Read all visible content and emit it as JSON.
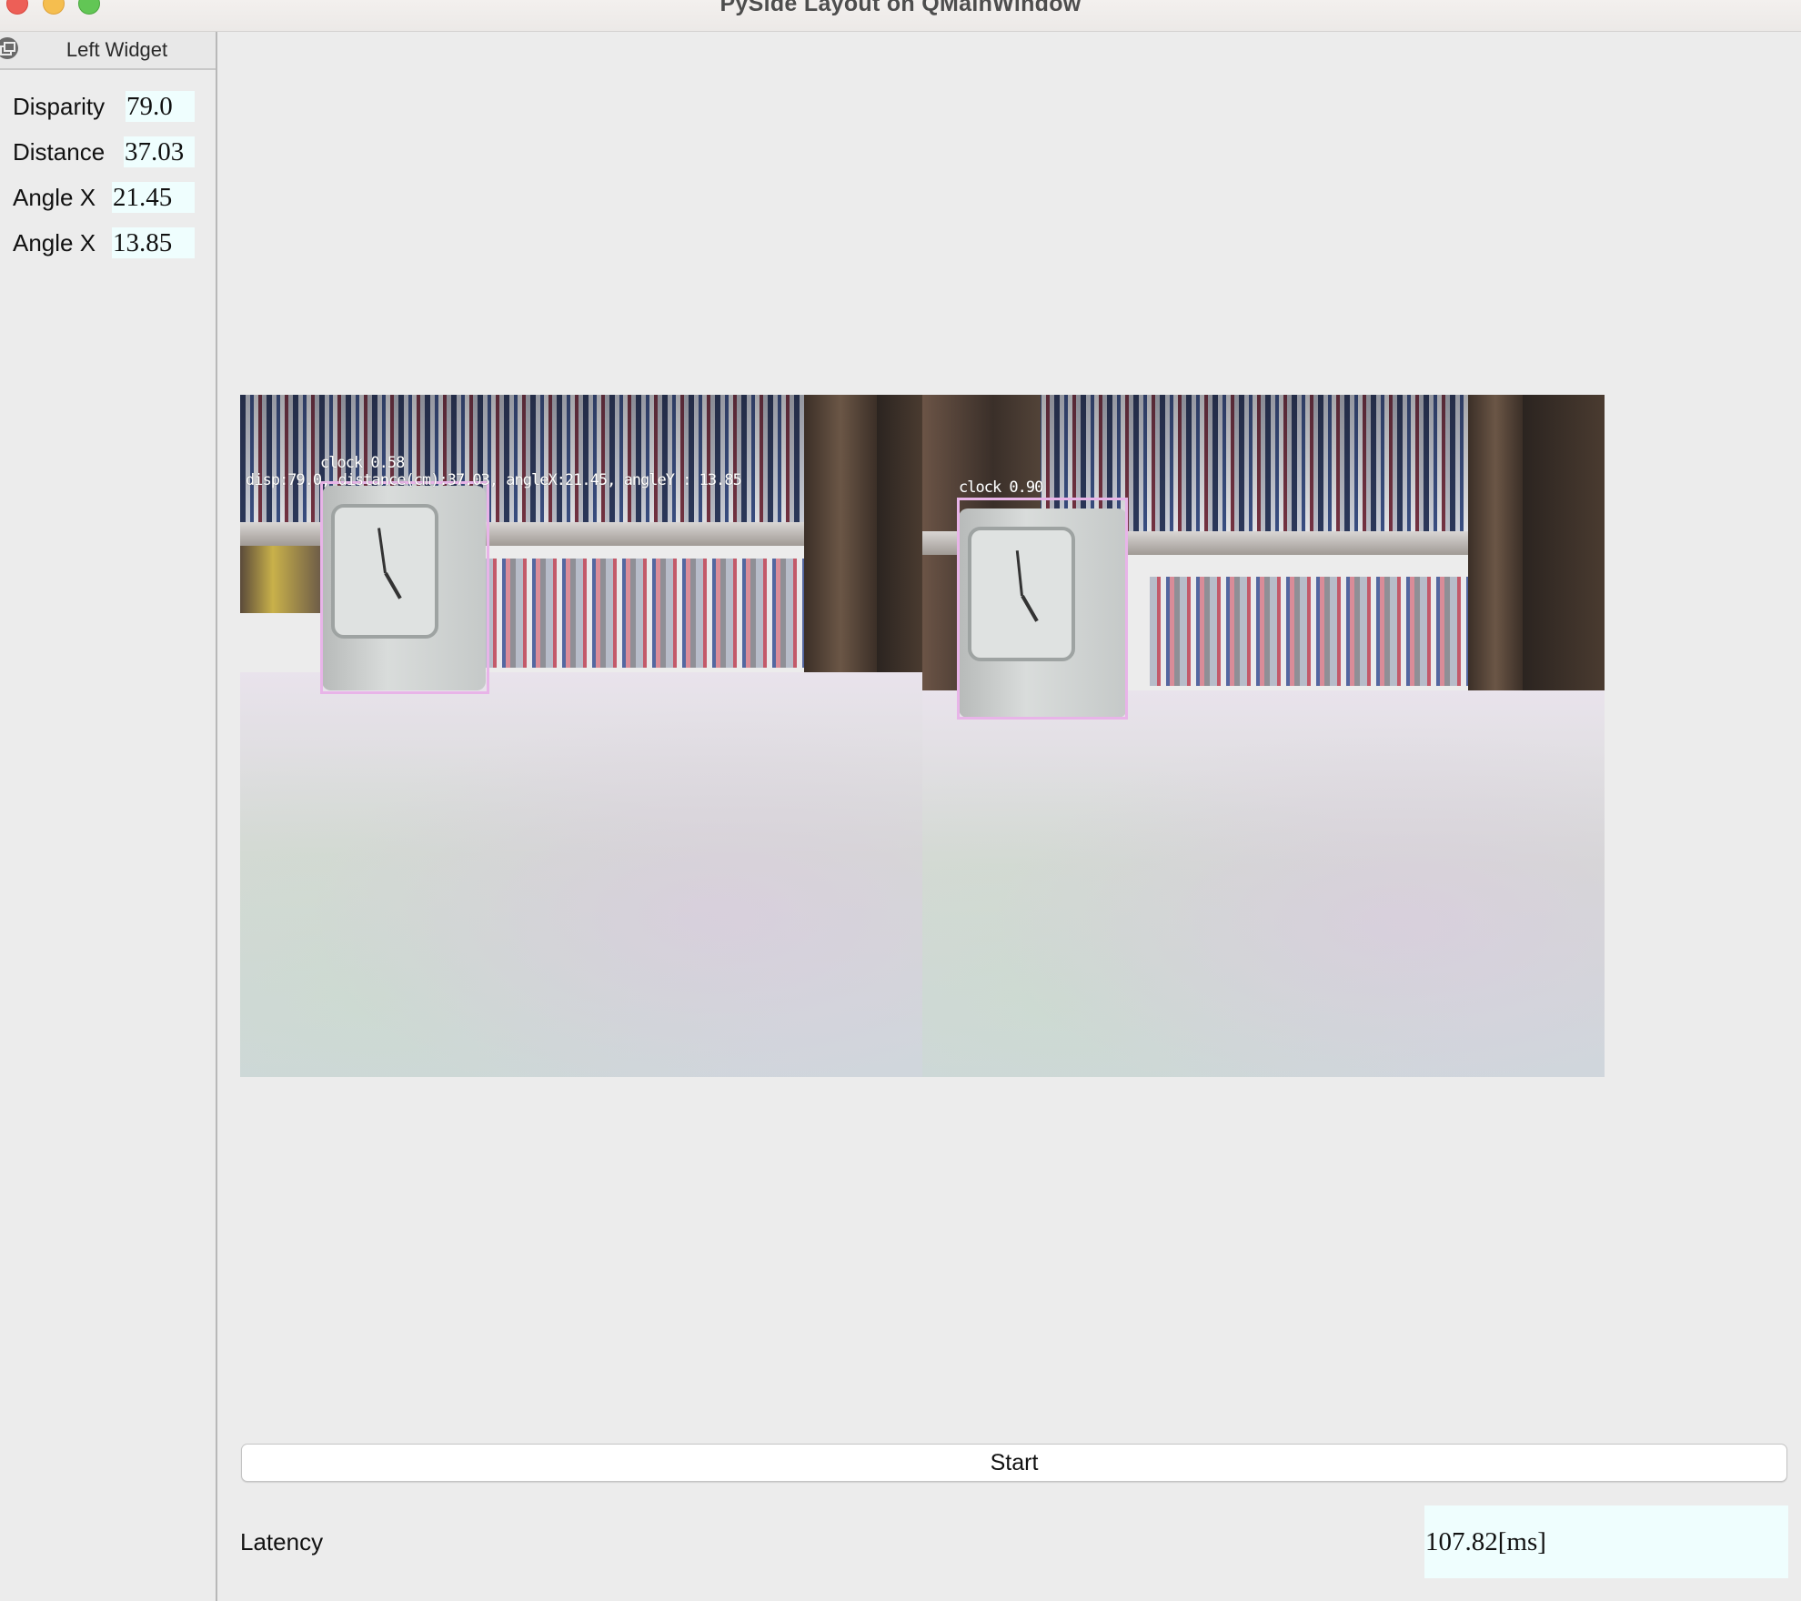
{
  "window": {
    "title": "PySide Layout on QMainWindow"
  },
  "dock": {
    "title": "Left Widget",
    "metrics": [
      {
        "label": "Disparity",
        "value": "79.0"
      },
      {
        "label": "Distance",
        "value": "37.03"
      },
      {
        "label": "Angle X",
        "value": "21.45"
      },
      {
        "label": "Angle X",
        "value": "13.85"
      }
    ]
  },
  "camera": {
    "left_class_label": "clock 0.58",
    "left_info_text": "disp:79.0, distance(cm):37.03, angleX:21.45, angleY : 13.85",
    "right_class_label": "clock 0.90",
    "bbox_color": "#e8b4e8"
  },
  "controls": {
    "start_label": "Start",
    "latency_label": "Latency",
    "latency_value": "107.82[ms]"
  }
}
